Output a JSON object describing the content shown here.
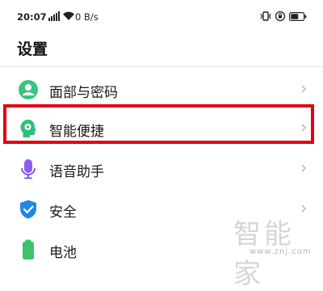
{
  "status_bar": {
    "time": "20:07",
    "network_speed": "0 B/s",
    "icons": [
      "signal-icon",
      "wifi-icon",
      "vibrate-icon",
      "rotation-lock-icon",
      "battery-icon"
    ]
  },
  "page": {
    "title": "设置"
  },
  "settings_list": [
    {
      "label": "面部与密码",
      "icon": "face-password-icon",
      "color": "#3cc47c"
    },
    {
      "label": "智能便捷",
      "icon": "smart-assist-icon",
      "color": "#2fbf7a"
    },
    {
      "label": "语音助手",
      "icon": "microphone-icon",
      "color": "#8c5cf5"
    },
    {
      "label": "安全",
      "icon": "shield-icon",
      "color": "#1e88e5"
    },
    {
      "label": "电池",
      "icon": "battery-icon",
      "color": "#3ec26a"
    }
  ],
  "highlight": {
    "color": "#e60012",
    "target": "智能便捷"
  },
  "watermark": {
    "text": "智能家",
    "url": "www.znj.com"
  }
}
